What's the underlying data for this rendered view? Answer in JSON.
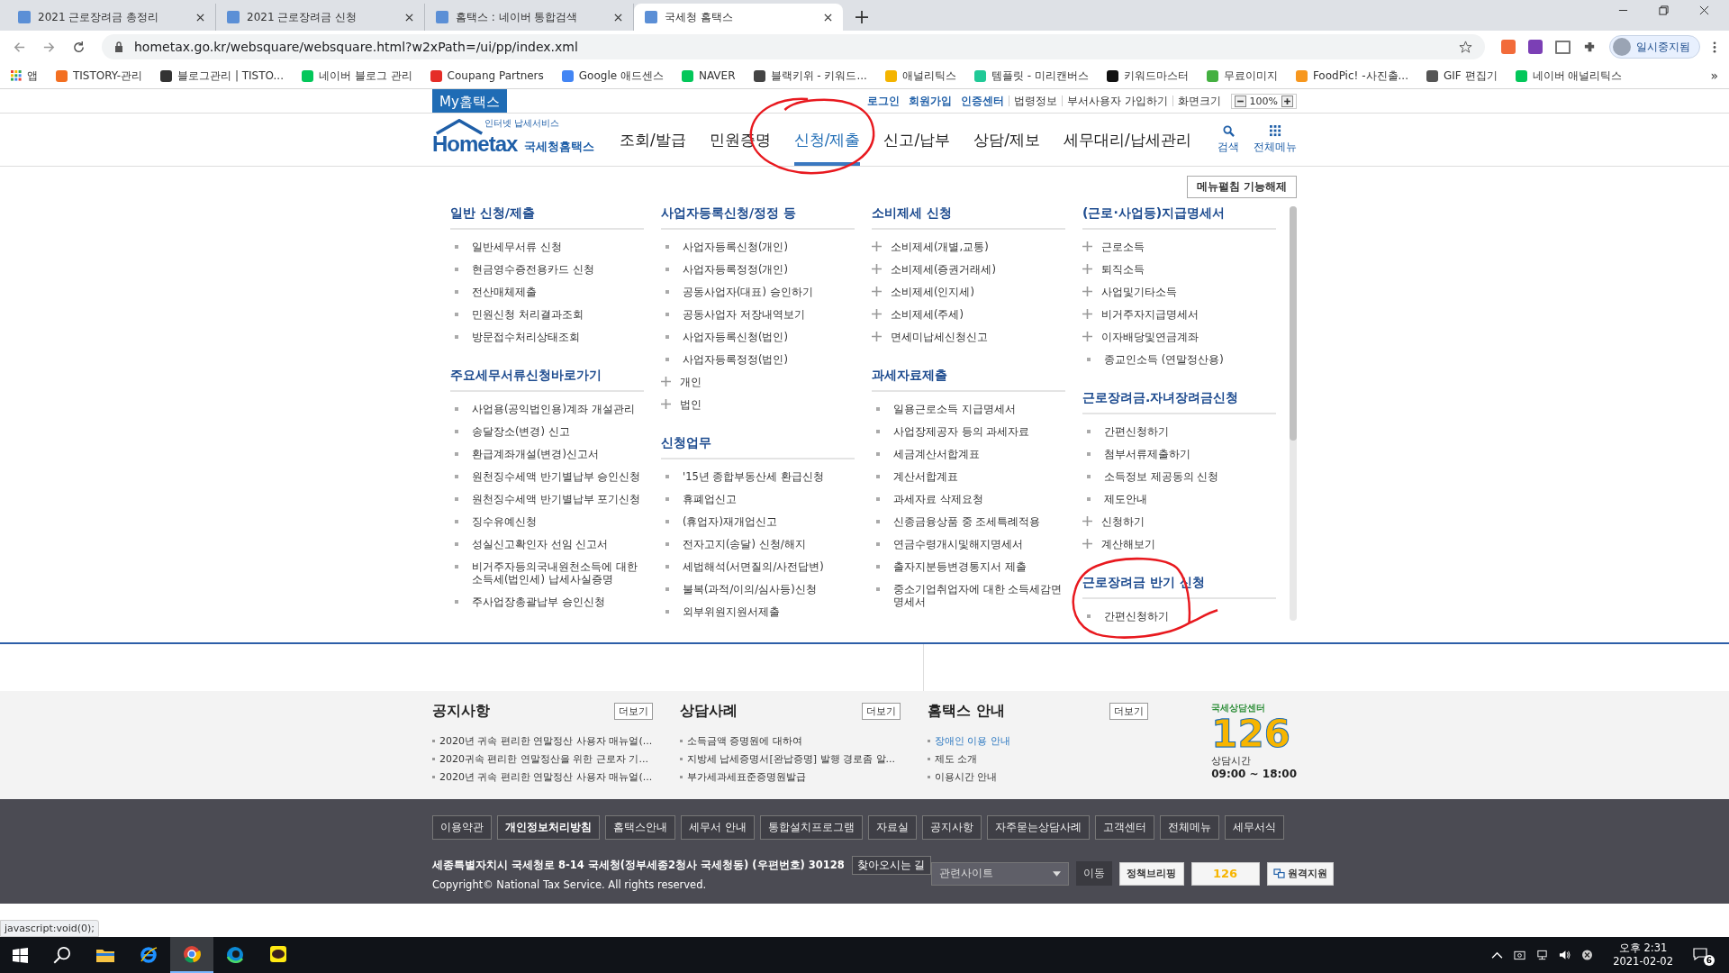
{
  "browser": {
    "tabs": [
      {
        "title": "2021 근로장려금 총정리",
        "selected": false
      },
      {
        "title": "2021 근로장려금 신청",
        "selected": false
      },
      {
        "title": "홈택스 : 네이버 통합검색",
        "selected": false
      },
      {
        "title": "국세청 홈택스",
        "selected": true
      }
    ],
    "address": "hometax.go.kr/websquare/websquare.html?w2xPath=/ui/pp/index.xml",
    "profile": "일시중지됨",
    "bookmarks": [
      "앱",
      "TISTORY-관리",
      "블로그관리 | TISTO...",
      "네이버 블로그 관리",
      "Coupang Partners",
      "Google 애드센스",
      "NAVER",
      "블랙키위 - 키워드...",
      "애널리틱스",
      "템플릿 - 미리캔버스",
      "키워드마스터",
      "무료이미지",
      "FoodPic! -사진출...",
      "GIF 편집기",
      "네이버 애널리틱스"
    ],
    "bookmarks_more": "»"
  },
  "utility": {
    "my_button": "My홈택스",
    "links": [
      {
        "label": "로그인",
        "emphasized": true
      },
      {
        "label": "회원가입",
        "emphasized": true
      },
      {
        "label": "인증센터",
        "emphasized": true
      },
      {
        "label": "법령정보",
        "emphasized": false
      },
      {
        "label": "부서사용자 가입하기",
        "emphasized": false
      },
      {
        "label": "화면크기",
        "emphasized": false
      }
    ],
    "zoom": "100%"
  },
  "header": {
    "logo": "Hometax",
    "logo_tagline": "인터넷 납세서비스",
    "logo_name": "국세청홈택스",
    "nav": [
      {
        "label": "조회/발급",
        "selected": false,
        "circled": false
      },
      {
        "label": "민원증명",
        "selected": false,
        "circled": false
      },
      {
        "label": "신청/제출",
        "selected": true,
        "circled": true
      },
      {
        "label": "신고/납부",
        "selected": false,
        "circled": false
      },
      {
        "label": "상담/제보",
        "selected": false,
        "circled": false
      },
      {
        "label": "세무대리/납세관리",
        "selected": false,
        "circled": false
      }
    ],
    "search": "검색",
    "all_menu": "전체메뉴"
  },
  "menu": {
    "toggle_button": "메뉴펼침 기능해제",
    "columns": [
      [
        {
          "title": "일반 신청/제출",
          "circled": false,
          "items": [
            {
              "label": "일반세무서류 신청",
              "kind": "bullet"
            },
            {
              "label": "현금영수증전용카드 신청",
              "kind": "bullet"
            },
            {
              "label": "전산매체제출",
              "kind": "bullet"
            },
            {
              "label": "민원신청 처리결과조회",
              "kind": "bullet"
            },
            {
              "label": "방문접수처리상태조회",
              "kind": "bullet"
            }
          ]
        },
        {
          "title": "주요세무서류신청바로가기",
          "circled": false,
          "items": [
            {
              "label": "사업용(공익법인용)계좌 개설관리",
              "kind": "bullet"
            },
            {
              "label": "송달장소(변경) 신고",
              "kind": "bullet"
            },
            {
              "label": "환급계좌개설(변경)신고서",
              "kind": "bullet"
            },
            {
              "label": "원천징수세액 반기별납부 승인신청",
              "kind": "bullet"
            },
            {
              "label": "원천징수세액 반기별납부 포기신청",
              "kind": "bullet"
            },
            {
              "label": "징수유예신청",
              "kind": "bullet"
            },
            {
              "label": "성실신고확인자 선임 신고서",
              "kind": "bullet"
            },
            {
              "label": "비거주자등의국내원천소득에 대한 소득세(법인세) 납세사실증명",
              "kind": "bullet"
            },
            {
              "label": "주사업장총괄납부 승인신청",
              "kind": "bullet"
            }
          ]
        }
      ],
      [
        {
          "title": "사업자등록신청/정정 등",
          "circled": false,
          "items": [
            {
              "label": "사업자등록신청(개인)",
              "kind": "bullet"
            },
            {
              "label": "사업자등록정정(개인)",
              "kind": "bullet"
            },
            {
              "label": "공동사업자(대표) 승인하기",
              "kind": "bullet"
            },
            {
              "label": "공동사업자 저장내역보기",
              "kind": "bullet"
            },
            {
              "label": "사업자등록신청(법인)",
              "kind": "bullet"
            },
            {
              "label": "사업자등록정정(법인)",
              "kind": "bullet"
            },
            {
              "label": "개인",
              "kind": "plus"
            },
            {
              "label": "법인",
              "kind": "plus"
            }
          ]
        },
        {
          "title": "신청업무",
          "circled": false,
          "items": [
            {
              "label": "'15년 종합부동산세 환급신청",
              "kind": "bullet"
            },
            {
              "label": "휴폐업신고",
              "kind": "bullet"
            },
            {
              "label": "(휴업자)재개업신고",
              "kind": "bullet"
            },
            {
              "label": "전자고지(송달) 신청/해지",
              "kind": "bullet"
            },
            {
              "label": "세법해석(서면질의/사전답변)",
              "kind": "bullet"
            },
            {
              "label": "불복(과적/이의/심사등)신청",
              "kind": "bullet"
            },
            {
              "label": "외부위원지원서제출",
              "kind": "bullet"
            }
          ]
        }
      ],
      [
        {
          "title": "소비제세 신청",
          "circled": false,
          "items": [
            {
              "label": "소비제세(개별,교통)",
              "kind": "plus"
            },
            {
              "label": "소비제세(증권거래세)",
              "kind": "plus"
            },
            {
              "label": "소비제세(인지세)",
              "kind": "plus"
            },
            {
              "label": "소비제세(주세)",
              "kind": "plus"
            },
            {
              "label": "면세미납세신청신고",
              "kind": "plus"
            }
          ]
        },
        {
          "title": "과세자료제출",
          "circled": false,
          "items": [
            {
              "label": "일용근로소득 지급명세서",
              "kind": "bullet"
            },
            {
              "label": "사업장제공자 등의 과세자료",
              "kind": "bullet"
            },
            {
              "label": "세금계산서합계표",
              "kind": "bullet"
            },
            {
              "label": "계산서합계표",
              "kind": "bullet"
            },
            {
              "label": "과세자료 삭제요청",
              "kind": "bullet"
            },
            {
              "label": "신종금융상품 중 조세특례적용",
              "kind": "bullet"
            },
            {
              "label": "연금수령개시및해지명세서",
              "kind": "bullet"
            },
            {
              "label": "출자지분등변경통지서 제출",
              "kind": "bullet"
            },
            {
              "label": "중소기업취업자에 대한 소득세감면명세서",
              "kind": "bullet"
            }
          ]
        }
      ],
      [
        {
          "title": "(근로·사업등)지급명세서",
          "circled": false,
          "items": [
            {
              "label": "근로소득",
              "kind": "plus"
            },
            {
              "label": "퇴직소득",
              "kind": "plus"
            },
            {
              "label": "사업및기타소득",
              "kind": "plus"
            },
            {
              "label": "비거주자지급명세서",
              "kind": "plus"
            },
            {
              "label": "이자배당및연금계좌",
              "kind": "plus"
            },
            {
              "label": "종교인소득 (연말정산용)",
              "kind": "bullet"
            }
          ]
        },
        {
          "title": "근로장려금.자녀장려금신청",
          "circled": false,
          "items": [
            {
              "label": "간편신청하기",
              "kind": "bullet"
            },
            {
              "label": "첨부서류제출하기",
              "kind": "bullet"
            },
            {
              "label": "소득정보 제공동의 신청",
              "kind": "bullet"
            },
            {
              "label": "제도안내",
              "kind": "bullet"
            },
            {
              "label": "신청하기",
              "kind": "plus"
            },
            {
              "label": "계산해보기",
              "kind": "plus"
            }
          ]
        },
        {
          "title": "근로장려금 반기 신청",
          "circled": true,
          "items": [
            {
              "label": "간편신청하기",
              "kind": "bullet"
            }
          ]
        }
      ]
    ]
  },
  "boards": [
    {
      "title": "공지사항",
      "more": "더보기",
      "items": [
        {
          "label": "2020년 귀속 편리한 연말정산 사용자 매뉴얼(...",
          "emphasized": false
        },
        {
          "label": "2020귀속 편리한 연말정산을 위한 근로자 기...",
          "emphasized": false
        },
        {
          "label": "2020년 귀속 편리한 연말정산 사용자 매뉴얼(...",
          "emphasized": false
        }
      ]
    },
    {
      "title": "상담사례",
      "more": "더보기",
      "items": [
        {
          "label": "소득금액 증명원에 대하여",
          "emphasized": false
        },
        {
          "label": "지방세 납세증명서[완납증명] 발행 경로좀 알...",
          "emphasized": false
        },
        {
          "label": "부가세과세표준증명원발급",
          "emphasized": false
        }
      ]
    },
    {
      "title": "홈택스 안내",
      "more": "더보기",
      "items": [
        {
          "label": "장애인 이용 안내",
          "emphasized": true
        },
        {
          "label": "제도 소개",
          "emphasized": false
        },
        {
          "label": "이용시간 안내",
          "emphasized": false
        }
      ]
    }
  ],
  "call_center": {
    "name": "국세상담센터",
    "number": "126",
    "hours_label": "상담시간",
    "hours": "09:00 ~ 18:00"
  },
  "footer": {
    "links": [
      {
        "label": "이용약관",
        "emphasized": false
      },
      {
        "label": "개인정보처리방침",
        "emphasized": true
      },
      {
        "label": "홈택스안내",
        "emphasized": false
      },
      {
        "label": "세무서 안내",
        "emphasized": false
      },
      {
        "label": "통합설치프로그램",
        "emphasized": false
      },
      {
        "label": "자료실",
        "emphasized": false
      },
      {
        "label": "공지사항",
        "emphasized": false
      },
      {
        "label": "자주묻는상담사례",
        "emphasized": false
      },
      {
        "label": "고객센터",
        "emphasized": false
      },
      {
        "label": "전체메뉴",
        "emphasized": false
      },
      {
        "label": "세무서식",
        "emphasized": false
      }
    ],
    "address": "세종특별자치시 국세청로 8-14 국세청(정부세종2청사 국세청동) (우편번호) 30128",
    "directions": "찾아오시는 길",
    "copyright": "Copyright© National Tax Service. All rights reserved.",
    "related_select": "관련사이트",
    "go_button": "이동",
    "banners": [
      {
        "label": "정책브리핑",
        "kind": "text"
      },
      {
        "label": "126",
        "kind": "number"
      },
      {
        "label": "원격지원",
        "kind": "remote"
      }
    ]
  },
  "status_bar": "javascript:void(0);",
  "taskbar": {
    "time": "오후 2:31",
    "date": "2021-02-02",
    "notifications": "6"
  }
}
